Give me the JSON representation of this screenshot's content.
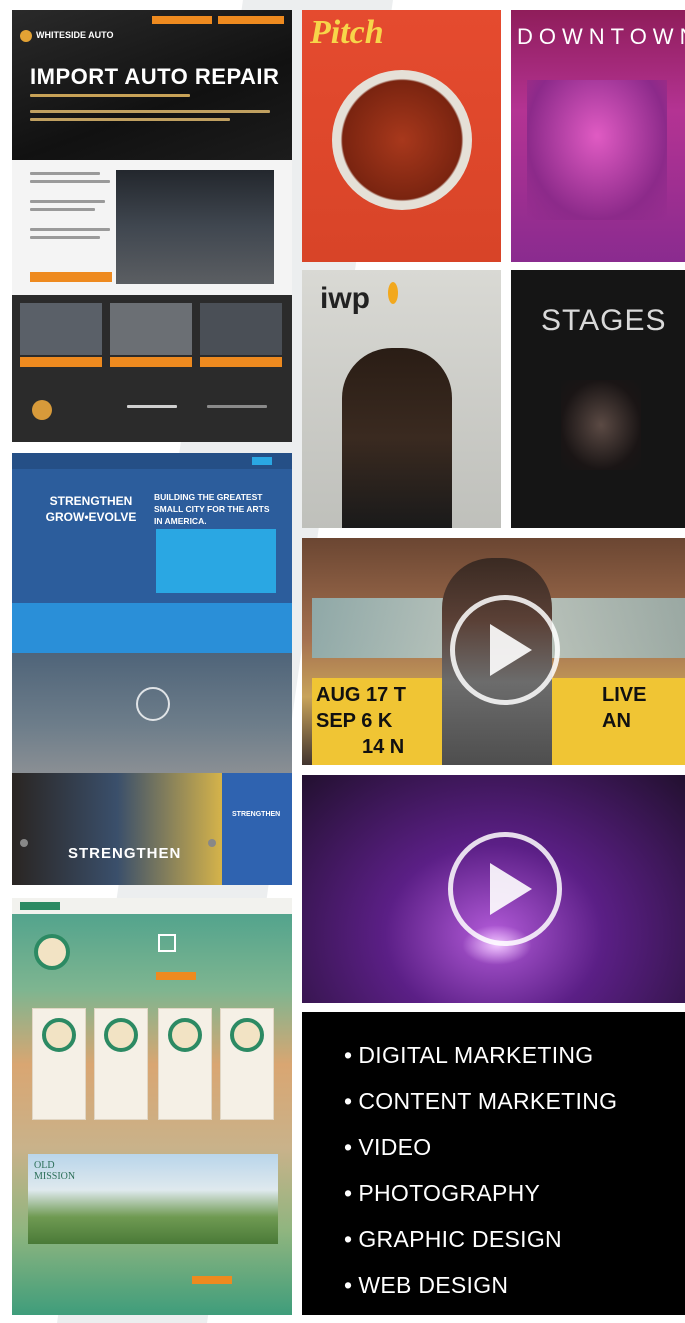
{
  "auto_site": {
    "headline": "IMPORT AUTO REPAIR",
    "brand": "WHITESIDE AUTO"
  },
  "theatre_site": {
    "tagline_line1": "STRENGTHEN",
    "tagline_line2": "GROW•EVOLVE",
    "headline_line1": "BUILDING THE GREATEST",
    "headline_line2": "SMALL CITY FOR THE ARTS",
    "headline_line3": "IN AMERICA.",
    "banner_word": "STRENGTHEN",
    "side_word": "STRENGTHEN"
  },
  "mission_site": {
    "logo_line1": "OLD",
    "logo_line2": "MISSION"
  },
  "magazines": {
    "pitch_title": "Pitch",
    "downtown_title": "DOWNTOWN",
    "iwp_title": "iwp",
    "stages_title": "STAGES"
  },
  "video1": {
    "marquee_row1": "AUG 17 T",
    "marquee_row1_right": "LIVE",
    "marquee_row2": "SEP 6 K",
    "marquee_row2_right": "AN",
    "marquee_row3": "14 N"
  },
  "services": {
    "bullet": "•",
    "items": [
      "DIGITAL MARKETING",
      "CONTENT MARKETING",
      "VIDEO",
      "PHOTOGRAPHY",
      "GRAPHIC DESIGN",
      "WEB DESIGN"
    ]
  },
  "colors": {
    "accent_orange": "#ee8a1f",
    "theatre_blue": "#2c5d9c",
    "services_bg": "#000000"
  }
}
